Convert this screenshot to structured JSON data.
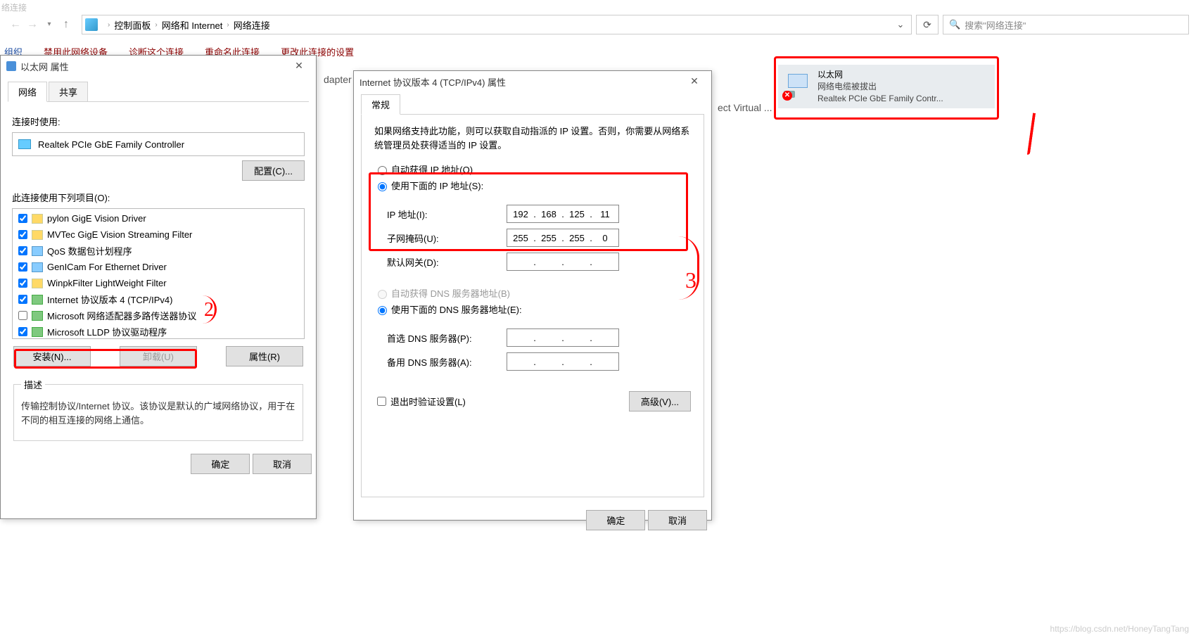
{
  "truncated_header": "络连接",
  "breadcrumb": {
    "items": [
      "控制面板",
      "网络和 Internet",
      "网络连接"
    ]
  },
  "search_placeholder": "搜索\"网络连接\"",
  "commandbar": {
    "org": "组织",
    "disable": "禁用此网络设备",
    "diag": "诊断这个连接",
    "rename": "重命名此连接",
    "change": "更改此连接的设置"
  },
  "bg_adapter": "dapter",
  "bg_virtual": "ect Virtual ...",
  "tile": {
    "name": "以太网",
    "status": "网络电缆被拔出",
    "device": "Realtek PCIe GbE Family Contr..."
  },
  "dlg1": {
    "title": "以太网 属性",
    "tab_network": "网络",
    "tab_share": "共享",
    "connect_using": "连接时使用:",
    "adapter": "Realtek PCIe GbE Family Controller",
    "configure": "配置(C)...",
    "uses_items": "此连接使用下列项目(O):",
    "items": [
      {
        "checked": true,
        "label": "pylon GigE Vision Driver",
        "cls": "pi"
      },
      {
        "checked": true,
        "label": "MVTec GigE Vision Streaming Filter",
        "cls": "pi"
      },
      {
        "checked": true,
        "label": "QoS 数据包计划程序",
        "cls": "pi blue"
      },
      {
        "checked": true,
        "label": "GenICam For Ethernet Driver",
        "cls": "pi blue"
      },
      {
        "checked": true,
        "label": "WinpkFilter LightWeight Filter",
        "cls": "pi"
      },
      {
        "checked": true,
        "label": "Internet 协议版本 4 (TCP/IPv4)",
        "cls": "pi net"
      },
      {
        "checked": false,
        "label": "Microsoft 网络适配器多路传送器协议",
        "cls": "pi net"
      },
      {
        "checked": true,
        "label": "Microsoft LLDP 协议驱动程序",
        "cls": "pi net"
      }
    ],
    "install": "安装(N)...",
    "uninstall": "卸载(U)",
    "properties": "属性(R)",
    "desc_legend": "描述",
    "desc": "传输控制协议/Internet 协议。该协议是默认的广域网络协议，用于在不同的相互连接的网络上通信。",
    "ok": "确定",
    "cancel": "取消"
  },
  "dlg2": {
    "title": "Internet 协议版本 4 (TCP/IPv4) 属性",
    "tab_general": "常规",
    "hint": "如果网络支持此功能，则可以获取自动指派的 IP 设置。否则，你需要从网络系统管理员处获得适当的 IP 设置。",
    "auto_ip": "自动获得 IP 地址(O)",
    "use_ip": "使用下面的 IP 地址(S):",
    "ip_label": "IP 地址(I):",
    "ip": [
      "192",
      "168",
      "125",
      "11"
    ],
    "mask_label": "子网掩码(U):",
    "mask": [
      "255",
      "255",
      "255",
      "0"
    ],
    "gw_label": "默认网关(D):",
    "gw": [
      "",
      "",
      "",
      ""
    ],
    "auto_dns": "自动获得 DNS 服务器地址(B)",
    "use_dns": "使用下面的 DNS 服务器地址(E):",
    "dns1_label": "首选 DNS 服务器(P):",
    "dns1": [
      "",
      "",
      "",
      ""
    ],
    "dns2_label": "备用 DNS 服务器(A):",
    "dns2": [
      "",
      "",
      "",
      ""
    ],
    "validate": "退出时验证设置(L)",
    "advanced": "高级(V)...",
    "ok": "确定",
    "cancel": "取消"
  },
  "annotations": {
    "n2": "2",
    "n3": "3"
  },
  "watermark": "https://blog.csdn.net/HoneyTangTang"
}
